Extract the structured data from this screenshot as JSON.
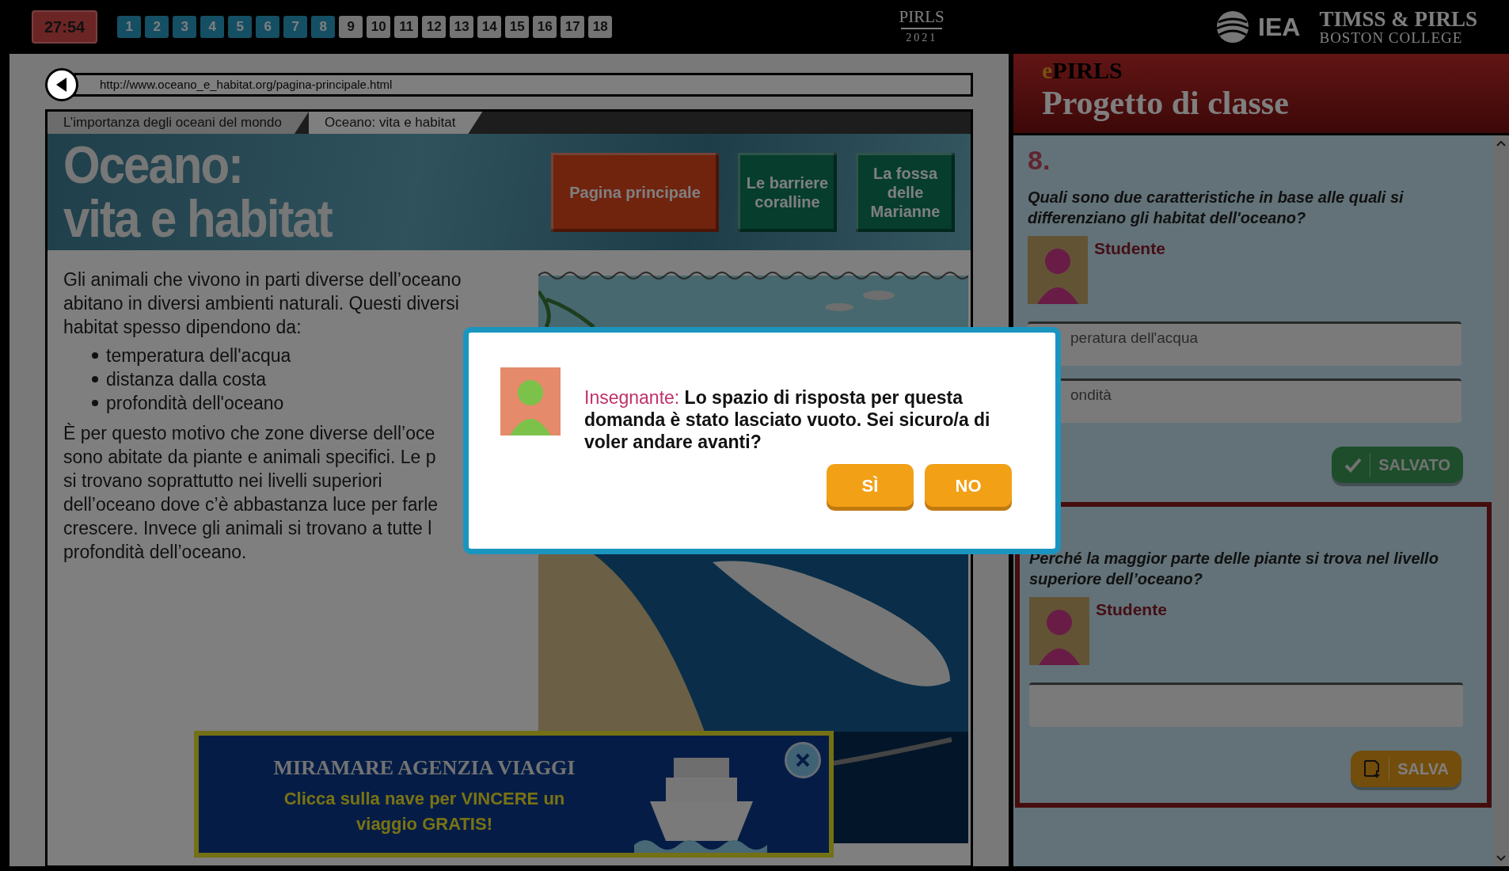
{
  "top_bar": {
    "timer": "27:54",
    "questions": [
      {
        "label": "1",
        "answered": true
      },
      {
        "label": "2",
        "answered": true
      },
      {
        "label": "3",
        "answered": true
      },
      {
        "label": "4",
        "answered": true
      },
      {
        "label": "5",
        "answered": true
      },
      {
        "label": "6",
        "answered": true
      },
      {
        "label": "7",
        "answered": true
      },
      {
        "label": "8",
        "answered": true
      },
      {
        "label": "9",
        "answered": false
      },
      {
        "label": "10",
        "answered": false
      },
      {
        "label": "11",
        "answered": false
      },
      {
        "label": "12",
        "answered": false
      },
      {
        "label": "13",
        "answered": false
      },
      {
        "label": "14",
        "answered": false
      },
      {
        "label": "15",
        "answered": false
      },
      {
        "label": "16",
        "answered": false
      },
      {
        "label": "17",
        "answered": false
      },
      {
        "label": "18",
        "answered": false
      }
    ],
    "logo_title": "PIRLS",
    "logo_year": "2021",
    "iea_logo": "IEA",
    "partner_line1": "TIMSS & PIRLS",
    "partner_line2": "BOSTON COLLEGE"
  },
  "browser": {
    "url": "http://www.oceano_e_habitat.org/pagina-principale.html",
    "tabs": [
      {
        "label": "L’importanza degli oceani del mondo",
        "selected": false
      },
      {
        "label": "Oceano: vita e habitat",
        "selected": true
      }
    ]
  },
  "site": {
    "title_line1": "Oceano:",
    "title_line2": "vita e habitat",
    "nav": [
      {
        "label": "Pagina principale",
        "selected": true
      },
      {
        "label": "Le barriere coralline",
        "selected": false
      },
      {
        "label": "La fossa delle Marianne",
        "selected": false
      }
    ],
    "intro": "Gli animali che vivono in parti diverse dell’oceano abitano in diversi ambienti naturali. Questi diversi habitat spesso dipendono da:",
    "bullets": [
      "temperatura dell'acqua",
      "distanza dalla costa",
      "profondità dell'oceano"
    ],
    "paragraph_lines": [
      "È per questo motivo che zone diverse dell’oce",
      "sono abitate da piante e animali specifici. Le p",
      "si trovano soprattutto nei livelli superiori",
      "dell’oceano dove c’è abbastanza luce per farle",
      "crescere. Invece gli animali si trovano a tutte l",
      "profondità dell’oceano."
    ],
    "ad": {
      "title": "MIRAMARE AGENZIA VIAGGI",
      "text": "Clicca sulla nave per VINCERE un viaggio GRATIS!"
    }
  },
  "panel": {
    "brand_prefix": "e",
    "brand": "PIRLS",
    "title": "Progetto di classe",
    "questions": [
      {
        "number": "8.",
        "text": "Quali sono due caratteristiche in base alle quali si differenziano gli habitat dell'oceano?",
        "speaker": "Studente",
        "answers": [
          "peratura dell'acqua",
          "ondità"
        ],
        "button": "SALVATO",
        "saved": true,
        "current": false
      },
      {
        "text": "Perché la maggior parte delle piante si trova nel livello superiore dell’oceano?",
        "speaker": "Studente",
        "button": "SALVA",
        "saved": false,
        "current": true
      }
    ]
  },
  "dialog": {
    "speaker": "Insegnante:",
    "message": "Lo spazio di risposta per questa domanda è stato lasciato vuoto. Sei sicuro/a di voler andare avanti?",
    "buttons": [
      "SÌ",
      "NO"
    ]
  }
}
